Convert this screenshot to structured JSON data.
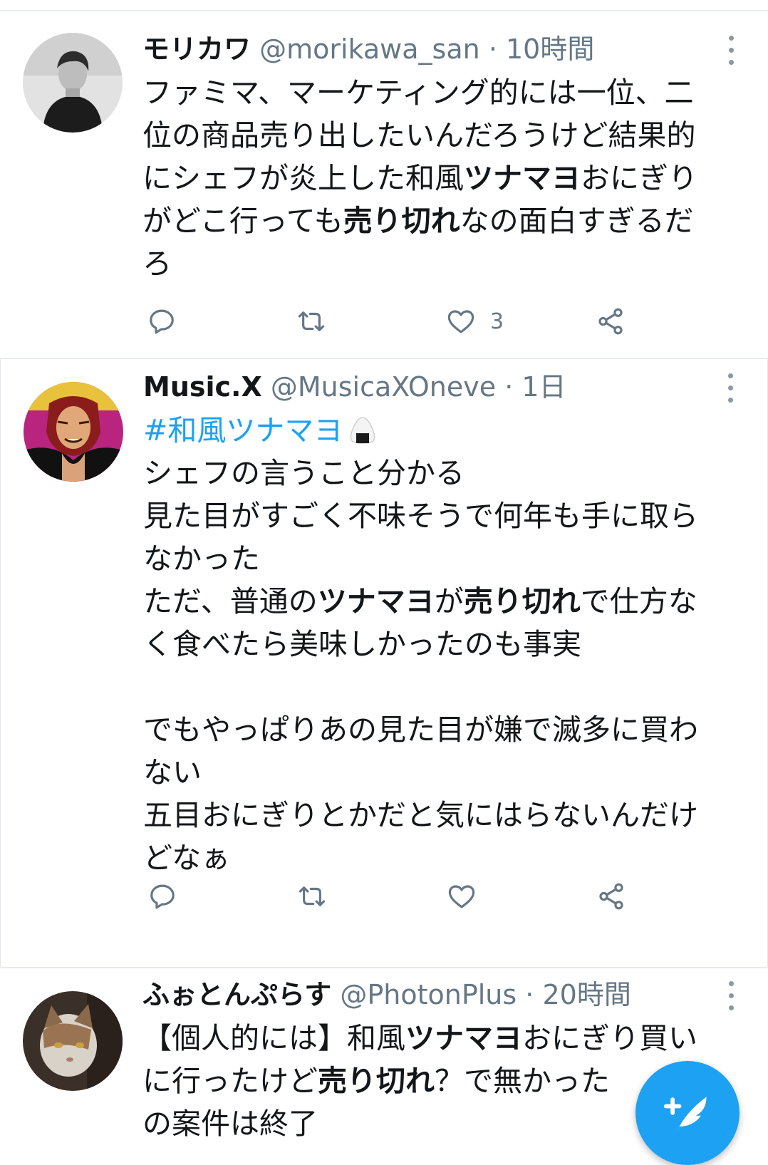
{
  "tweets": [
    {
      "name": "モリカワ",
      "handle": "@morikawa_san",
      "dot": "·",
      "time": "10時間",
      "lines": [
        [
          {
            "t": "ファミマ、マーケティング的には一位、二"
          }
        ],
        [
          {
            "t": "位の商品売り出したいんだろうけど結果的"
          }
        ],
        [
          {
            "t": "にシェフが炎上した和風"
          },
          {
            "t": "ツナマヨ",
            "b": true
          },
          {
            "t": "おにぎり"
          }
        ],
        [
          {
            "t": "がどこ行っても"
          },
          {
            "t": "売り切れ",
            "b": true
          },
          {
            "t": "なの面白すぎるだ"
          }
        ],
        [
          {
            "t": "ろ"
          }
        ]
      ],
      "like_count": "3"
    },
    {
      "name": "Music.X",
      "handle": "@MusicaXOneve",
      "dot": "·",
      "time": "1日",
      "hashtag": "#和風ツナマヨ",
      "lines": [
        [
          {
            "t": "シェフの言うこと分かる"
          }
        ],
        [
          {
            "t": "見た目がすごく不味そうで何年も手に取ら"
          }
        ],
        [
          {
            "t": "なかった"
          }
        ],
        [
          {
            "t": "ただ、普通の"
          },
          {
            "t": "ツナマヨ",
            "b": true
          },
          {
            "t": "が"
          },
          {
            "t": "売り切れ",
            "b": true
          },
          {
            "t": "で仕方な"
          }
        ],
        [
          {
            "t": "く食べたら美味しかったのも事実"
          }
        ],
        [],
        [
          {
            "t": "でもやっぱりあの見た目が嫌で滅多に買わ"
          }
        ],
        [
          {
            "t": "ない"
          }
        ],
        [
          {
            "t": "五目おにぎりとかだと気にはらないんだけ"
          }
        ],
        [
          {
            "t": "どなぁ"
          }
        ]
      ],
      "like_count": ""
    },
    {
      "name": "ふぉとんぷらす",
      "handle": "@PhotonPlus",
      "dot": "·",
      "time": "20時間",
      "lines": [
        [
          {
            "t": "【個人的には】和風"
          },
          {
            "t": "ツナマヨ",
            "b": true
          },
          {
            "t": "おにぎり買い"
          }
        ],
        [
          {
            "t": "に行ったけど"
          },
          {
            "t": "売り切れ",
            "b": true
          },
          {
            "t": "？で無かった"
          }
        ],
        [
          {
            "t": "の案件は終了"
          }
        ]
      ]
    }
  ],
  "icons": {
    "reply": "reply-icon",
    "retweet": "retweet-icon",
    "like": "like-icon",
    "share": "share-icon",
    "more": "more-icon",
    "compose": "compose-tweet-icon",
    "onigiri": "onigiri-emoji"
  },
  "colors": {
    "accent": "#1da1f2",
    "secondary_text": "#657786",
    "divider": "#e6ecf0"
  }
}
